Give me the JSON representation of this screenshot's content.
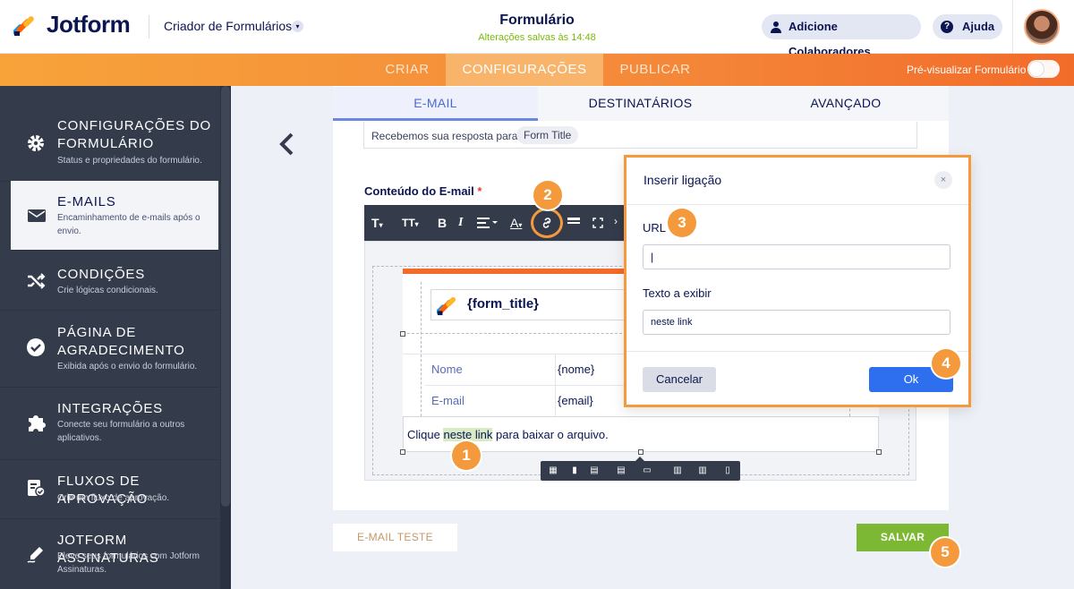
{
  "header": {
    "brand": "Jotform",
    "creator_menu": "Criador de Formulários",
    "form_title": "Formulário",
    "saved_status": "Alterações salvas às 14:48",
    "collaborators_btn": "Adicione Colaboradores",
    "help_btn": "Ajuda"
  },
  "nav": {
    "tabs": [
      "CRIAR",
      "CONFIGURAÇÕES",
      "PUBLICAR"
    ],
    "active": "CONFIGURAÇÕES",
    "preview_label": "Pré-visualizar Formulário"
  },
  "sidebar": {
    "items": [
      {
        "title": "CONFIGURAÇÕES DO FORMULÁRIO",
        "subtitle": "Status e propriedades do formulário.",
        "icon": "gear-icon"
      },
      {
        "title": "E-MAILS",
        "subtitle": "Encaminhamento de e-mails após o envio.",
        "icon": "envelope-icon",
        "active": true
      },
      {
        "title": "CONDIÇÕES",
        "subtitle": "Crie lógicas condicionais.",
        "icon": "shuffle-icon"
      },
      {
        "title": "PÁGINA DE AGRADECIMENTO",
        "subtitle": "Exibida após o envio do formulário.",
        "icon": "check-circle-icon"
      },
      {
        "title": "INTEGRAÇÕES",
        "subtitle": "Conecte seu formulário a outros aplicativos.",
        "icon": "puzzle-icon"
      },
      {
        "title": "FLUXOS DE APROVAÇÃO",
        "subtitle": "Crie um fluxo de aprovação.",
        "icon": "approval-icon"
      },
      {
        "title": "JOTFORM ASSINATURAS",
        "subtitle": "Eleve seus formulários com Jotform Assinaturas.",
        "icon": "pen-icon"
      }
    ]
  },
  "email_tabs": [
    "E-MAIL",
    "DESTINATÁRIOS",
    "AVANÇADO"
  ],
  "subject": {
    "text": "Recebemos sua resposta para",
    "tag": "Form Title"
  },
  "content": {
    "label": "Conteúdo do E-mail",
    "required_mark": "*",
    "form_title_tag": "{form_title}",
    "rows": [
      {
        "label": "Nome",
        "value": "{nome}"
      },
      {
        "label": "E-mail",
        "value": "{email}"
      }
    ],
    "click_before": "Clique ",
    "click_link": "neste link",
    "click_after": " para baixar o arquivo."
  },
  "toolbar": {
    "items": [
      "T",
      "TT",
      "B",
      "I",
      "align",
      "A",
      "link",
      "hr",
      "fullscreen"
    ]
  },
  "modal": {
    "title": "Inserir ligação",
    "close": "×",
    "url_label": "URL",
    "url_value": "|",
    "text_label": "Texto a exibir",
    "text_value": "neste link",
    "cancel": "Cancelar",
    "ok": "Ok"
  },
  "footer": {
    "test_btn": "E-MAIL TESTE",
    "save_btn": "SALVAR"
  },
  "callouts": [
    "1",
    "2",
    "3",
    "4",
    "5"
  ],
  "colors": {
    "accent_orange": "#f49a3d",
    "brand_navy": "#0a1551",
    "save_green": "#7cb833",
    "ok_blue": "#2e6ff0"
  }
}
